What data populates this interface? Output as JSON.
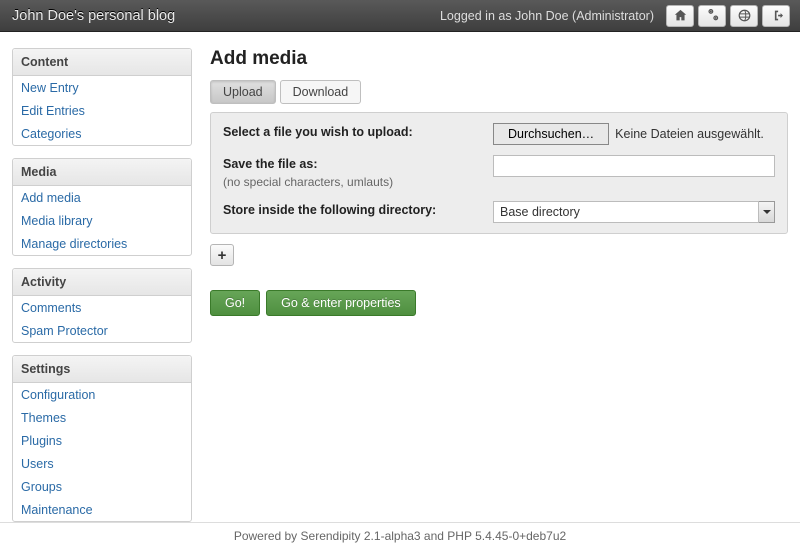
{
  "topbar": {
    "title": "John Doe's personal blog",
    "logged_in_as": "Logged in as John Doe (Administrator)"
  },
  "sidebar": {
    "sections": [
      {
        "title": "Content",
        "items": [
          "New Entry",
          "Edit Entries",
          "Categories"
        ]
      },
      {
        "title": "Media",
        "items": [
          "Add media",
          "Media library",
          "Manage directories"
        ]
      },
      {
        "title": "Activity",
        "items": [
          "Comments",
          "Spam Protector"
        ]
      },
      {
        "title": "Settings",
        "items": [
          "Configuration",
          "Themes",
          "Plugins",
          "Users",
          "Groups",
          "Maintenance"
        ]
      }
    ]
  },
  "main": {
    "title": "Add media",
    "tabs": {
      "upload": "Upload",
      "download": "Download",
      "active": "upload"
    },
    "form": {
      "select_label": "Select a file you wish to upload:",
      "browse_button": "Durchsuchen…",
      "file_status": "Keine Dateien ausgewählt.",
      "saveas_label": "Save the file as:",
      "saveas_hint": "(no special characters, umlauts)",
      "saveas_value": "",
      "directory_label": "Store inside the following directory:",
      "directory_value": "Base directory"
    },
    "add_button": "+",
    "go_button": "Go!",
    "go_props_button": "Go & enter properties"
  },
  "footer": {
    "text": "Powered by Serendipity 2.1-alpha3 and PHP 5.4.45-0+deb7u2"
  }
}
